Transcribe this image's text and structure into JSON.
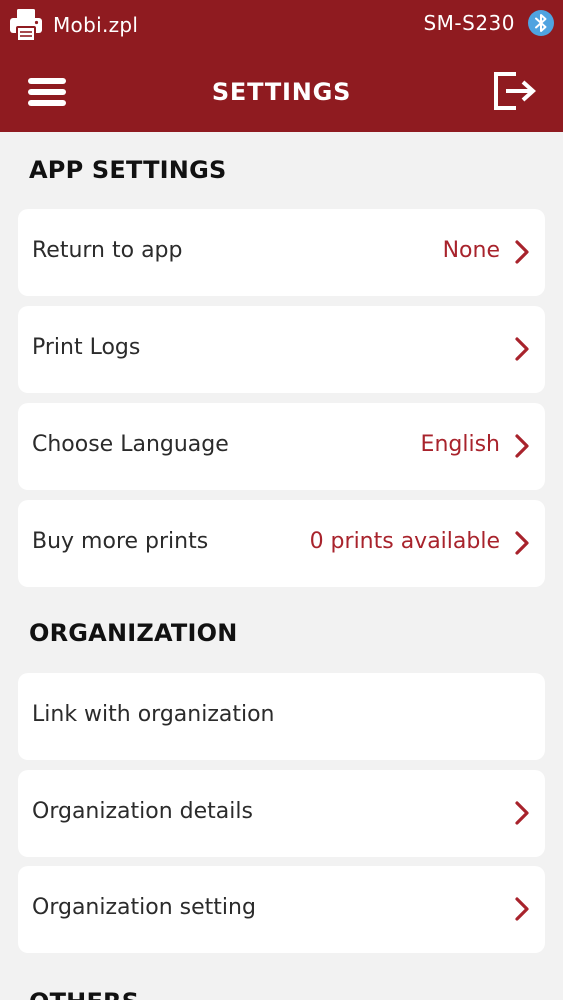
{
  "status_bar": {
    "app_name": "Mobi.zpl",
    "device_name": "SM-S230",
    "icons": [
      "printer-icon",
      "bluetooth-icon"
    ]
  },
  "nav": {
    "title": "SETTINGS",
    "icons": [
      "hamburger-menu-icon",
      "logout-icon"
    ]
  },
  "colors": {
    "brand": "#8f1b20",
    "accent": "#a8232c",
    "background": "#f2f2f2",
    "card": "#ffffff"
  },
  "sections": {
    "app_settings": {
      "title": "APP SETTINGS",
      "rows": [
        {
          "label": "Return to app",
          "value": "None"
        },
        {
          "label": "Print Logs",
          "value": ""
        },
        {
          "label": "Choose Language",
          "value": "English"
        },
        {
          "label": "Buy more prints",
          "value": "0 prints available"
        }
      ]
    },
    "organization": {
      "title": "ORGANIZATION",
      "rows": [
        {
          "label": "Link with organization",
          "value": ""
        },
        {
          "label": "Organization details",
          "value": ""
        },
        {
          "label": "Organization setting",
          "value": ""
        }
      ]
    },
    "others": {
      "title": "OTHERS"
    }
  }
}
